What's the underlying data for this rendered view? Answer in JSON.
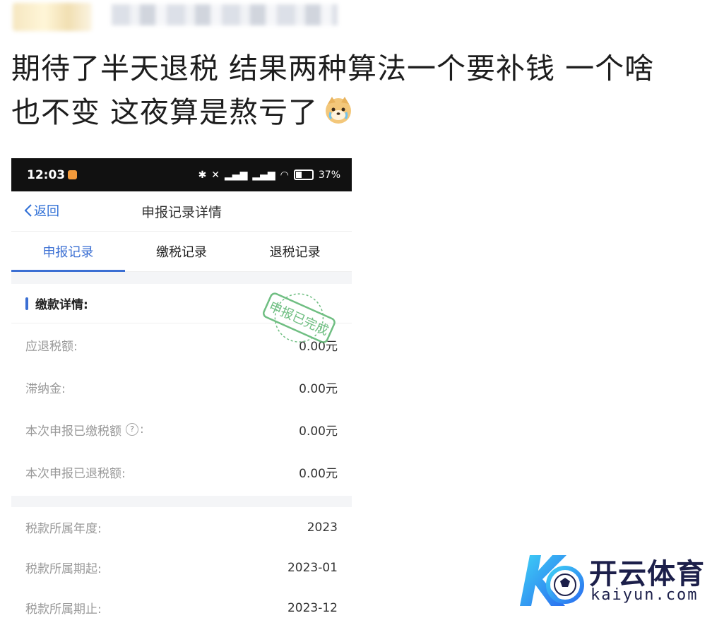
{
  "post": {
    "line1": "期待了半天退税 结果两种算法一个要补钱  一个啥",
    "line2": "也不变 这夜算是熬亏了"
  },
  "phone": {
    "status_bar": {
      "time": "12:03",
      "battery": "37%"
    },
    "nav": {
      "back_label": "返回",
      "title": "申报记录详情"
    },
    "tabs": [
      {
        "label": "申报记录",
        "active": true
      },
      {
        "label": "缴税记录",
        "active": false
      },
      {
        "label": "退税记录",
        "active": false
      }
    ],
    "section_title": "缴款详情:",
    "stamp_text": "申报已完成",
    "rows": [
      {
        "label": "应退税额:",
        "value": "0.00元"
      },
      {
        "label": "滞纳金:",
        "value": "0.00元"
      },
      {
        "label": "本次申报已缴税额",
        "label_suffix": ":",
        "value": "0.00元",
        "help": "?"
      },
      {
        "label": "本次申报已退税额:",
        "value": "0.00元"
      }
    ],
    "rows2": [
      {
        "label": "税款所属年度:",
        "value": "2023"
      },
      {
        "label": "税款所属期起:",
        "value": "2023-01"
      },
      {
        "label": "税款所属期止:",
        "value": "2023-12"
      }
    ]
  },
  "watermark": {
    "cn": "开云体育",
    "en": "kaiyun.com"
  },
  "colors": {
    "accent": "#3b6fd3",
    "stamp": "#4caf63"
  }
}
